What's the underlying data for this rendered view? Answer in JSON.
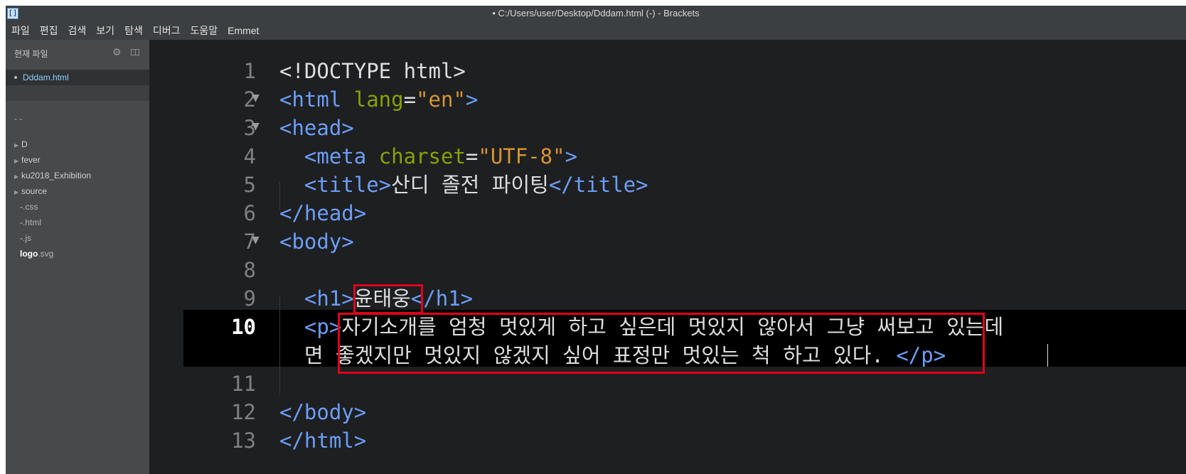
{
  "window": {
    "title": "• C:/Users/user/Desktop/Dddam.html (-) - Brackets"
  },
  "menu": [
    "파일",
    "편집",
    "검색",
    "보기",
    "탐색",
    "디버그",
    "도움말",
    "Emmet"
  ],
  "sidebar": {
    "working_title": "현재 파일",
    "working_files": [
      "Dddam.html"
    ],
    "project_title": "- -",
    "tree": [
      {
        "name": "D",
        "type": "folder"
      },
      {
        "name": "fever",
        "type": "folder"
      },
      {
        "name": "ku2018_Exhibition",
        "type": "folder"
      },
      {
        "name": "source",
        "type": "folder"
      },
      {
        "name": "-",
        "ext": ".css",
        "type": "file"
      },
      {
        "name": "-",
        "ext": ".html",
        "type": "file"
      },
      {
        "name": "-",
        "ext": ".js",
        "type": "file"
      },
      {
        "name": "logo",
        "ext": ".svg",
        "type": "file"
      }
    ]
  },
  "editor": {
    "active_line": 10,
    "line_numbers": [
      "1",
      "2",
      "3",
      "4",
      "5",
      "6",
      "7",
      "8",
      "9",
      "10",
      "11",
      "12",
      "13"
    ],
    "fold_lines": [
      2,
      3,
      7
    ],
    "code": {
      "l1": "<!DOCTYPE html>",
      "l2_open": "<html ",
      "l2_attr": "lang",
      "l2_eq": "=",
      "l2_val": "\"en\"",
      "l2_close": ">",
      "l3": "<head>",
      "l4_open": "<meta ",
      "l4_attr": "charset",
      "l4_eq": "=",
      "l4_val": "\"UTF-8\"",
      "l4_close": ">",
      "l5_open": "<title>",
      "l5_text": "산디 졸전 파이팅",
      "l5_close": "</title>",
      "l6": "</head>",
      "l7": "<body>",
      "l9_open": "<h1>",
      "l9_text": "윤태웅",
      "l9_close": "</h1>",
      "l10_open": "<p>",
      "l10_text_a": "자기소개를 엄청 멋있게 하고 싶은데 멋있지 않아서 그냥 써보고 있는데",
      "l10_text_b": "면 좋겠지만 멋있지 않겠지 싶어 표정만 멋있는 척 하고 있다. ",
      "l10_close": "</p>",
      "l12": "</body>",
      "l13": "</html>"
    }
  },
  "colors": {
    "tag": "#6c9ef8",
    "attr": "#85a300",
    "string": "#d89333",
    "text": "#dddddd",
    "highlight_box": "#e0001b"
  }
}
